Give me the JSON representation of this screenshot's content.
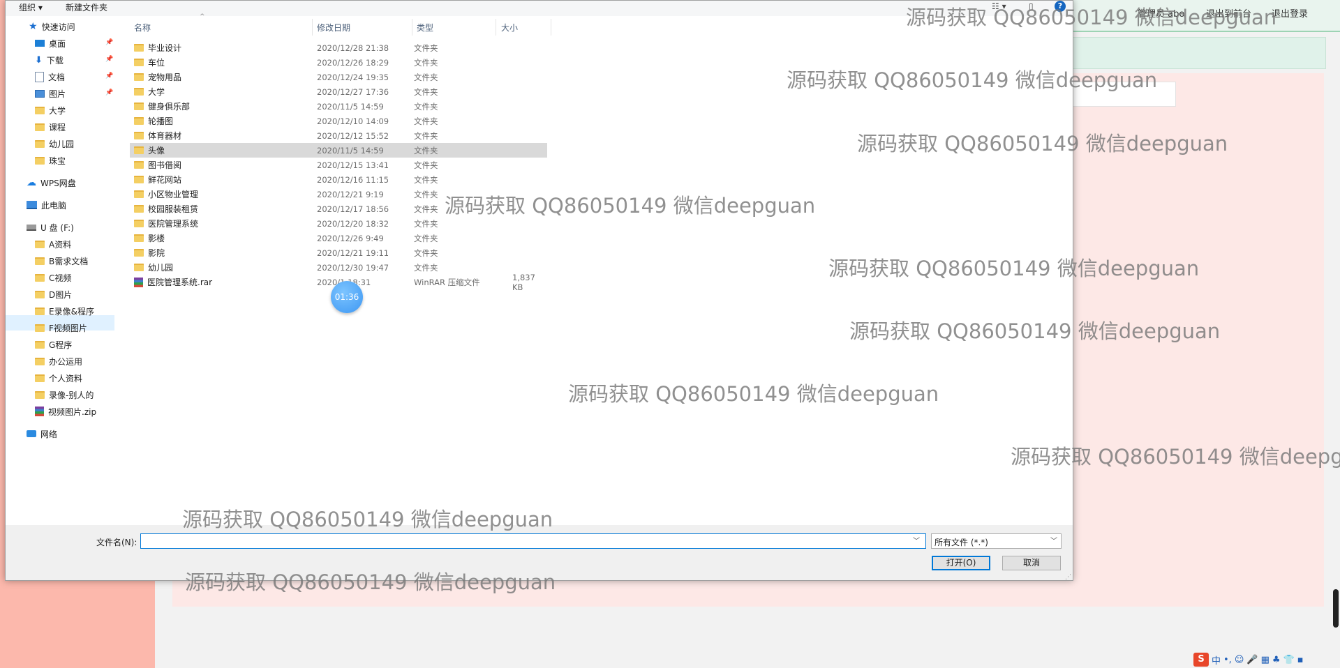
{
  "background": {
    "top_links": [
      "管理员 abo",
      "退出到前台",
      "退出登录"
    ]
  },
  "dialog": {
    "commands": [
      "组织 ▾",
      "新建文件夹"
    ],
    "help_label": "?",
    "columns": [
      "名称",
      "修改日期",
      "类型",
      "大小"
    ],
    "nav": [
      {
        "label": "快速访问",
        "icon": "star-icon",
        "pinned": false
      },
      {
        "label": "桌面",
        "icon": "desktop-icon",
        "pinned": true
      },
      {
        "label": "下载",
        "icon": "download-icon",
        "pinned": true
      },
      {
        "label": "文档",
        "icon": "document-icon",
        "pinned": true
      },
      {
        "label": "图片",
        "icon": "pictures-icon",
        "pinned": true
      },
      {
        "label": "大学",
        "icon": "folder-icon",
        "pinned": false
      },
      {
        "label": "课程",
        "icon": "folder-icon",
        "pinned": false
      },
      {
        "label": "幼儿园",
        "icon": "folder-icon",
        "pinned": false
      },
      {
        "label": "珠宝",
        "icon": "folder-icon",
        "pinned": false
      },
      {
        "label": "WPS网盘",
        "icon": "cloud-icon",
        "pinned": false
      },
      {
        "label": "此电脑",
        "icon": "computer-icon",
        "pinned": false
      },
      {
        "label": "U 盘 (F:)",
        "icon": "drive-icon",
        "pinned": false
      },
      {
        "label": "A资料",
        "icon": "folder-icon",
        "pinned": false
      },
      {
        "label": "B需求文档",
        "icon": "folder-icon",
        "pinned": false
      },
      {
        "label": "C视频",
        "icon": "folder-icon",
        "pinned": false
      },
      {
        "label": "D图片",
        "icon": "folder-icon",
        "pinned": false
      },
      {
        "label": "E录像&程序",
        "icon": "folder-icon",
        "pinned": false
      },
      {
        "label": "F视频图片",
        "icon": "folder-icon",
        "pinned": false
      },
      {
        "label": "G程序",
        "icon": "folder-icon",
        "pinned": false
      },
      {
        "label": "办公运用",
        "icon": "folder-icon",
        "pinned": false
      },
      {
        "label": "个人资料",
        "icon": "folder-icon",
        "pinned": false
      },
      {
        "label": "录像-别人的",
        "icon": "folder-icon",
        "pinned": false
      },
      {
        "label": "视频图片.zip",
        "icon": "archive-icon",
        "pinned": false
      },
      {
        "label": "网络",
        "icon": "network-icon",
        "pinned": false
      }
    ],
    "files": [
      {
        "name": "毕业设计",
        "date": "2020/12/28 21:38",
        "type": "文件夹",
        "size": "",
        "icon": "folder-icon"
      },
      {
        "name": "车位",
        "date": "2020/12/26 18:29",
        "type": "文件夹",
        "size": "",
        "icon": "folder-icon"
      },
      {
        "name": "宠物用品",
        "date": "2020/12/24 19:35",
        "type": "文件夹",
        "size": "",
        "icon": "folder-icon"
      },
      {
        "name": "大学",
        "date": "2020/12/27 17:36",
        "type": "文件夹",
        "size": "",
        "icon": "folder-icon"
      },
      {
        "name": "健身俱乐部",
        "date": "2020/11/5 14:59",
        "type": "文件夹",
        "size": "",
        "icon": "folder-icon"
      },
      {
        "name": "轮播图",
        "date": "2020/12/10 14:09",
        "type": "文件夹",
        "size": "",
        "icon": "folder-icon"
      },
      {
        "name": "体育器材",
        "date": "2020/12/12 15:52",
        "type": "文件夹",
        "size": "",
        "icon": "folder-icon"
      },
      {
        "name": "头像",
        "date": "2020/11/5 14:59",
        "type": "文件夹",
        "size": "",
        "icon": "folder-icon",
        "selected": true
      },
      {
        "name": "图书借阅",
        "date": "2020/12/15 13:41",
        "type": "文件夹",
        "size": "",
        "icon": "folder-icon"
      },
      {
        "name": "鲜花网站",
        "date": "2020/12/16 11:15",
        "type": "文件夹",
        "size": "",
        "icon": "folder-icon"
      },
      {
        "name": "小区物业管理",
        "date": "2020/12/21 9:19",
        "type": "文件夹",
        "size": "",
        "icon": "folder-icon"
      },
      {
        "name": "校园服装租赁",
        "date": "2020/12/17 18:56",
        "type": "文件夹",
        "size": "",
        "icon": "folder-icon"
      },
      {
        "name": "医院管理系统",
        "date": "2020/12/20 18:32",
        "type": "文件夹",
        "size": "",
        "icon": "folder-icon"
      },
      {
        "name": "影楼",
        "date": "2020/12/26 9:49",
        "type": "文件夹",
        "size": "",
        "icon": "folder-icon"
      },
      {
        "name": "影院",
        "date": "2020/12/21 19:11",
        "type": "文件夹",
        "size": "",
        "icon": "folder-icon"
      },
      {
        "name": "幼儿园",
        "date": "2020/12/30 19:47",
        "type": "文件夹",
        "size": "",
        "icon": "folder-icon"
      },
      {
        "name": "医院管理系统.rar",
        "date": "2020/1  18:31",
        "type": "WinRAR 压缩文件",
        "size": "1,837 KB",
        "icon": "archive-icon"
      }
    ],
    "filename_label": "文件名(N):",
    "filename_value": "",
    "filetype_value": "所有文件 (*.*)",
    "open_label": "打开(O)",
    "cancel_label": "取消"
  },
  "timer": "01:36",
  "watermark": "源码获取 QQ86050149 微信deepguan",
  "taskbar_items": [
    "S",
    "中",
    "•,",
    "☺",
    "🎤",
    "▦",
    "♣",
    "👕",
    "▪"
  ]
}
